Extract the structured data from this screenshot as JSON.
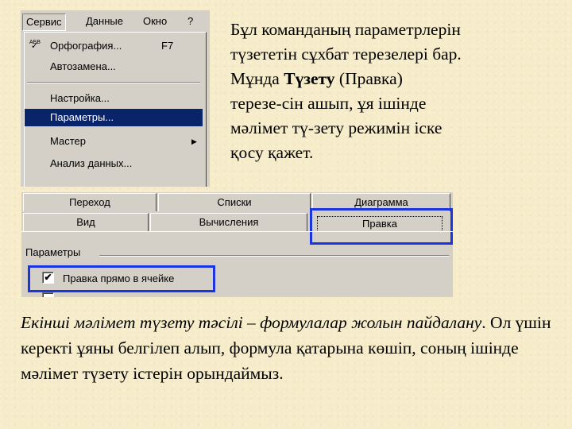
{
  "menu_screenshot": {
    "menubar": [
      "Сервис",
      "Данные",
      "Окно",
      "?"
    ],
    "items": [
      {
        "label": "Орфография...",
        "shortcut": "F7",
        "icon": "spelling-check-icon",
        "icon_text": "АБВ"
      },
      {
        "label": "Автозамена..."
      },
      {
        "label": "Настройка..."
      },
      {
        "label": "Параметры..."
      },
      {
        "label": "Мастер",
        "submenu_arrow": "▶"
      },
      {
        "label": "Анализ данных..."
      }
    ],
    "highlight_color": "#0a246a"
  },
  "top_paragraph": {
    "line1": "Бұл команданың параметрлерін",
    "line2": "түзететін сұхбат терезелері бар.",
    "line3_prefix": "Мұнда ",
    "line3_bold": "Түзету",
    "line3_suffix": " (Правка)",
    "line4": "терезе-сін ашып, ұя ішінде",
    "line5": "мәлімет тү-зету режимін іске",
    "line6": "қосу қажет."
  },
  "dialog_screenshot": {
    "tabs_row1": [
      "Переход",
      "Списки",
      "Диаграмма"
    ],
    "tabs_row2": [
      "Вид",
      "Вычисления",
      "Правка"
    ],
    "group_label": "Параметры",
    "option_label": "Правка прямо в ячейке",
    "option_checked": "✔",
    "highlight_color": "#1a35e0"
  },
  "bottom_paragraph": {
    "italic": "Екінші мәлімет түзету тәсілі – формулалар жолын пайдалану",
    "rest": ". Ол үшін керекті ұяны белгілеп алып, формула қатарына көшіп, соның ішінде мәлімет түзету істерін орындаймыз."
  }
}
